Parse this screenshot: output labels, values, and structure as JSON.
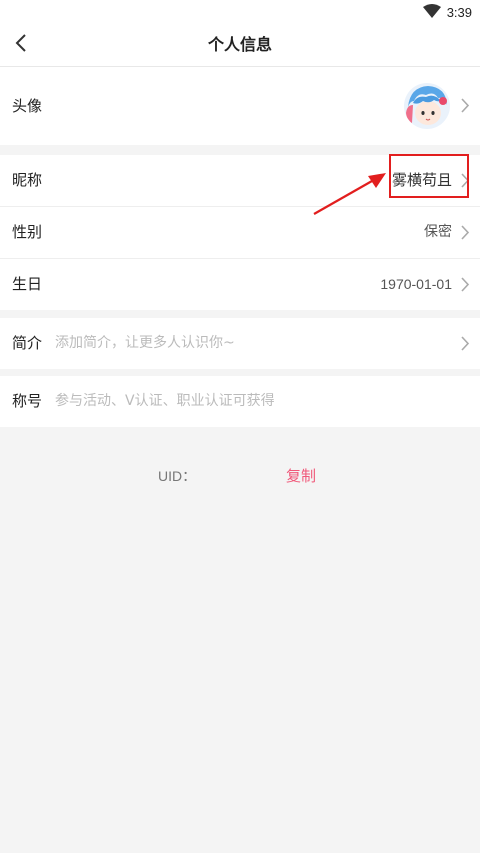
{
  "status_bar": {
    "time": "3:39"
  },
  "header": {
    "title": "个人信息"
  },
  "profile": {
    "avatar_label": "头像",
    "nickname_label": "昵称",
    "nickname_value": "雾横苟且",
    "gender_label": "性别",
    "gender_value": "保密",
    "birthday_label": "生日",
    "birthday_value": "1970-01-01"
  },
  "bio": {
    "label": "简介",
    "placeholder": "添加简介，让更多人认识你~"
  },
  "title_row": {
    "label": "称号",
    "placeholder": "参与活动、V认证、职业认证可获得"
  },
  "uid": {
    "label": "UID：",
    "copy_label": "复制"
  },
  "colors": {
    "accent": "#f0597a",
    "annotation": "#e21e1e"
  },
  "icons": {
    "back": "chevron-left-icon",
    "row_arrow": "chevron-right-icon",
    "wifi": "wifi-icon"
  }
}
